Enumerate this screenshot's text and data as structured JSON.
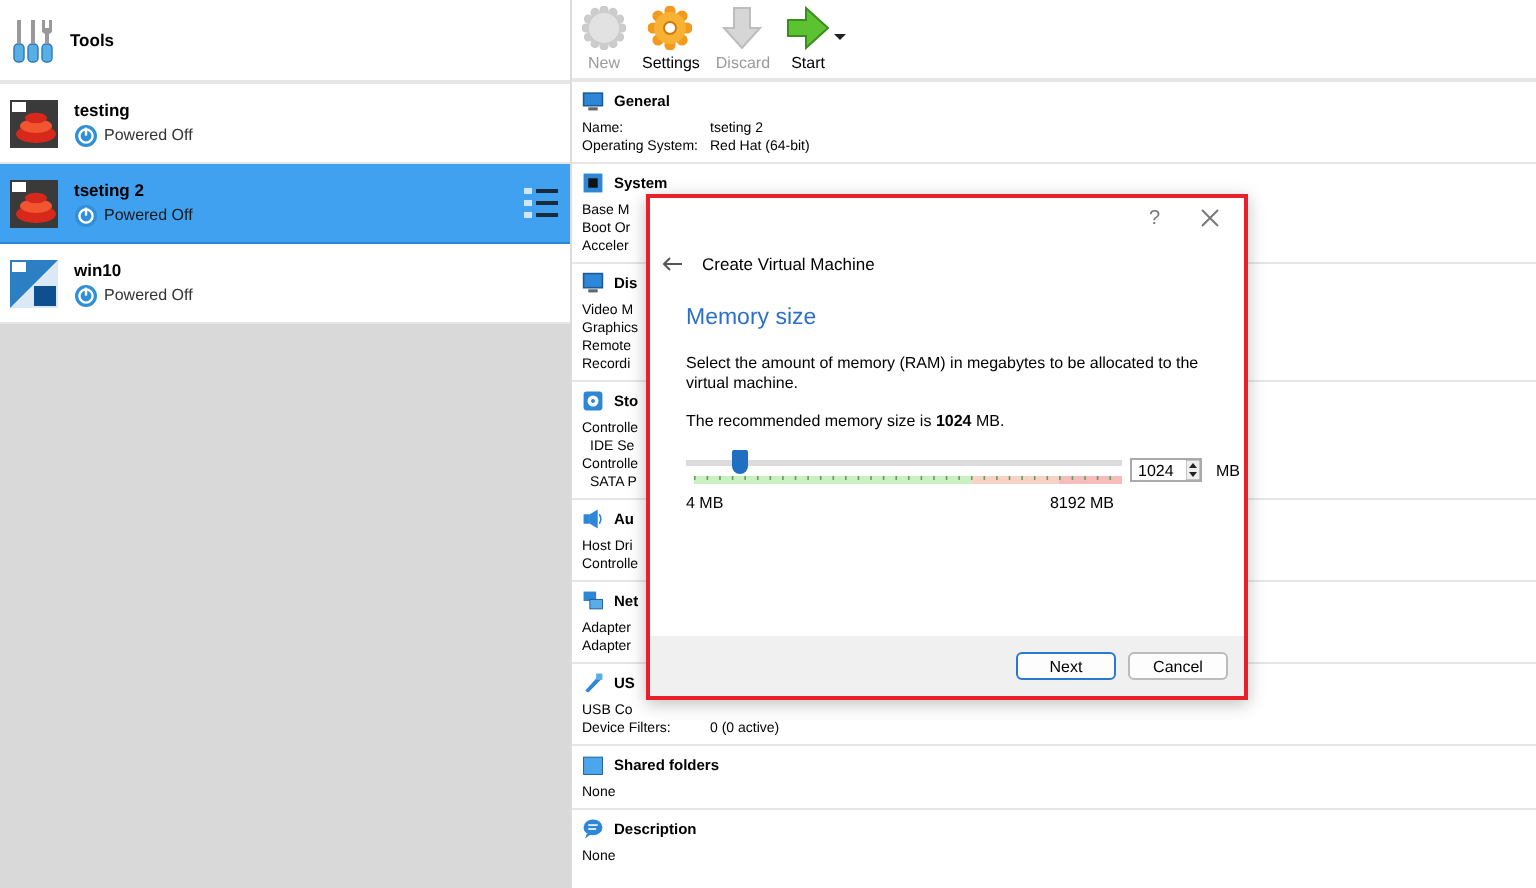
{
  "sidebar": {
    "tools_label": "Tools",
    "machines": [
      {
        "name": "testing",
        "state": "Powered Off",
        "kind": "redhat",
        "selected": false
      },
      {
        "name": "tseting 2",
        "state": "Powered Off",
        "kind": "redhat",
        "selected": true
      },
      {
        "name": "win10",
        "state": "Powered Off",
        "kind": "windows",
        "selected": false
      }
    ]
  },
  "toolbar": {
    "buttons": [
      {
        "label": "New",
        "kind": "new",
        "disabled": true
      },
      {
        "label": "Settings",
        "kind": "settings",
        "disabled": false
      },
      {
        "label": "Discard",
        "kind": "discard",
        "disabled": true
      },
      {
        "label": "Start",
        "kind": "start",
        "disabled": false
      }
    ]
  },
  "details": {
    "sections": [
      {
        "kind": "general",
        "title": "General",
        "rows": [
          {
            "label": "Name:",
            "value": "tseting 2"
          },
          {
            "label": "Operating System:",
            "value": "Red Hat (64-bit)"
          }
        ]
      },
      {
        "kind": "system",
        "title": "System",
        "rows": [
          {
            "label": "Base M"
          },
          {
            "label": "Boot Or"
          },
          {
            "label": "Acceler"
          }
        ]
      },
      {
        "kind": "display",
        "title": "Dis",
        "rows": [
          {
            "label": "Video M"
          },
          {
            "label": "Graphics"
          },
          {
            "label": "Remote"
          },
          {
            "label": "Recordi"
          }
        ]
      },
      {
        "kind": "storage",
        "title": "Sto",
        "rows": [
          {
            "label": "Controlle",
            "indented": false
          },
          {
            "label": "IDE Se",
            "indented": true
          },
          {
            "label": "Controlle",
            "indented": false
          },
          {
            "label": "SATA P",
            "indented": true
          }
        ]
      },
      {
        "kind": "audio",
        "title": "Au",
        "rows": [
          {
            "label": "Host Dri"
          },
          {
            "label": "Controlle"
          }
        ]
      },
      {
        "kind": "network",
        "title": "Net",
        "rows": [
          {
            "label": "Adapter"
          },
          {
            "label": "Adapter"
          }
        ]
      },
      {
        "kind": "usb",
        "title": "US",
        "rows": [
          {
            "label": "USB Co"
          },
          {
            "label": "Device Filters:",
            "value": "0 (0 active)"
          }
        ]
      },
      {
        "kind": "shared",
        "title": "Shared folders",
        "rows": [
          {
            "label": "None"
          }
        ]
      },
      {
        "kind": "description",
        "title": "Description",
        "rows": [
          {
            "label": "None"
          }
        ]
      }
    ]
  },
  "dialog": {
    "help": "?",
    "heading": "Create Virtual Machine",
    "title": "Memory size",
    "description": "Select the amount of memory (RAM) in megabytes to be allocated to the virtual machine.",
    "recommendation": "The recommended memory size is **1024** MB.",
    "slider": {
      "level": 0.125,
      "min_label": "4 MB",
      "max_label": "8192 MB"
    },
    "spin_value": "1024",
    "unit": "MB",
    "buttons": [
      {
        "label": "Next",
        "default": true
      },
      {
        "label": "Cancel",
        "default": false
      }
    ]
  }
}
